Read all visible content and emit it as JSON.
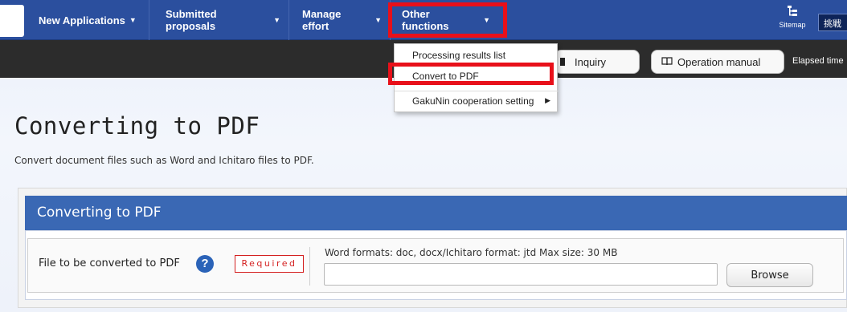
{
  "nav": {
    "items": [
      {
        "label": "New Applications"
      },
      {
        "label": "Submitted proposals"
      },
      {
        "label": "Manage effort"
      },
      {
        "label": "Other functions"
      }
    ],
    "sitemap_label": "Sitemap",
    "challenge_label": "挑戦"
  },
  "toolbar": {
    "inquiry_label": "Inquiry",
    "manual_label": "Operation manual",
    "elapsed_label": "Elapsed time"
  },
  "dropdown": {
    "items": [
      {
        "label": "Processing results list"
      },
      {
        "label": "Convert to PDF"
      },
      {
        "label": "GakuNin cooperation setting"
      }
    ]
  },
  "page": {
    "title": "Converting to PDF",
    "description": "Convert document files such as Word and Ichitaro files to PDF."
  },
  "panel": {
    "header": "Converting to PDF",
    "field_label": "File to be converted to PDF",
    "help_icon": "?",
    "required_label": "Required",
    "format_hint": "Word formats: doc, docx/Ichitaro format: jtd   Max size: 30 MB",
    "file_value": "",
    "browse_label": "Browse"
  },
  "colors": {
    "nav_bg": "#2b4f9e",
    "dark_bar": "#2c2c2c",
    "panel_header": "#3a68b4",
    "highlight": "#e8101a",
    "required": "#d42020"
  },
  "icons": {
    "sitemap": "sitemap-icon",
    "book": "book-icon",
    "help": "question-icon",
    "submenu": "chevron-right-icon"
  }
}
